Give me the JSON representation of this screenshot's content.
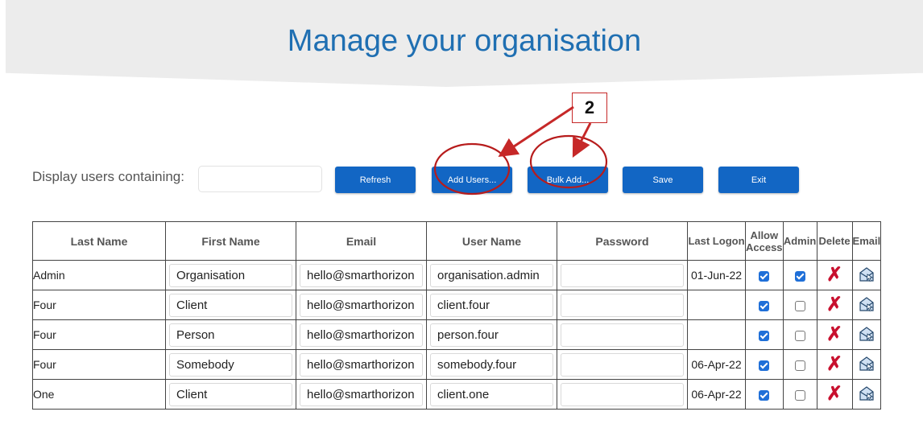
{
  "header": {
    "title": "Manage your organisation"
  },
  "toolbar": {
    "filter_label": "Display users containing:",
    "filter_value": "",
    "buttons": {
      "refresh": "Refresh",
      "add_users": "Add Users...",
      "bulk_add": "Bulk Add...",
      "save": "Save",
      "exit": "Exit"
    }
  },
  "annotation": {
    "label": "2",
    "color": "#c62828"
  },
  "table": {
    "headers": {
      "last_name": "Last Name",
      "first_name": "First Name",
      "email": "Email",
      "user_name": "User Name",
      "password": "Password",
      "last_logon": "Last Logon",
      "allow_access_1": "Allow",
      "allow_access_2": "Access",
      "admin": "Admin",
      "delete": "Delete",
      "email_action": "Email"
    },
    "rows": [
      {
        "last_name": "Admin",
        "first_name": "Organisation",
        "email": "hello@smarthorizon",
        "user_name": "organisation.admin",
        "password": "",
        "last_logon": "01-Jun-22",
        "allow_access": true,
        "admin": true
      },
      {
        "last_name": "Four",
        "first_name": "Client",
        "email": "hello@smarthorizon",
        "user_name": "client.four",
        "password": "",
        "last_logon": "",
        "allow_access": true,
        "admin": false
      },
      {
        "last_name": "Four",
        "first_name": "Person",
        "email": "hello@smarthorizon",
        "user_name": "person.four",
        "password": "",
        "last_logon": "",
        "allow_access": true,
        "admin": false
      },
      {
        "last_name": "Four",
        "first_name": "Somebody",
        "email": "hello@smarthorizon",
        "user_name": "somebody.four",
        "password": "",
        "last_logon": "06-Apr-22",
        "allow_access": true,
        "admin": false
      },
      {
        "last_name": "One",
        "first_name": "Client",
        "email": "hello@smarthorizon",
        "user_name": "client.one",
        "password": "",
        "last_logon": "06-Apr-22",
        "allow_access": true,
        "admin": false
      }
    ],
    "icons": {
      "delete": "delete-x-icon",
      "email": "send-email-icon"
    }
  },
  "colors": {
    "title": "#1f6fb2",
    "button": "#1266c4",
    "delete": "#c8102e",
    "check": "#1f6fd8"
  }
}
